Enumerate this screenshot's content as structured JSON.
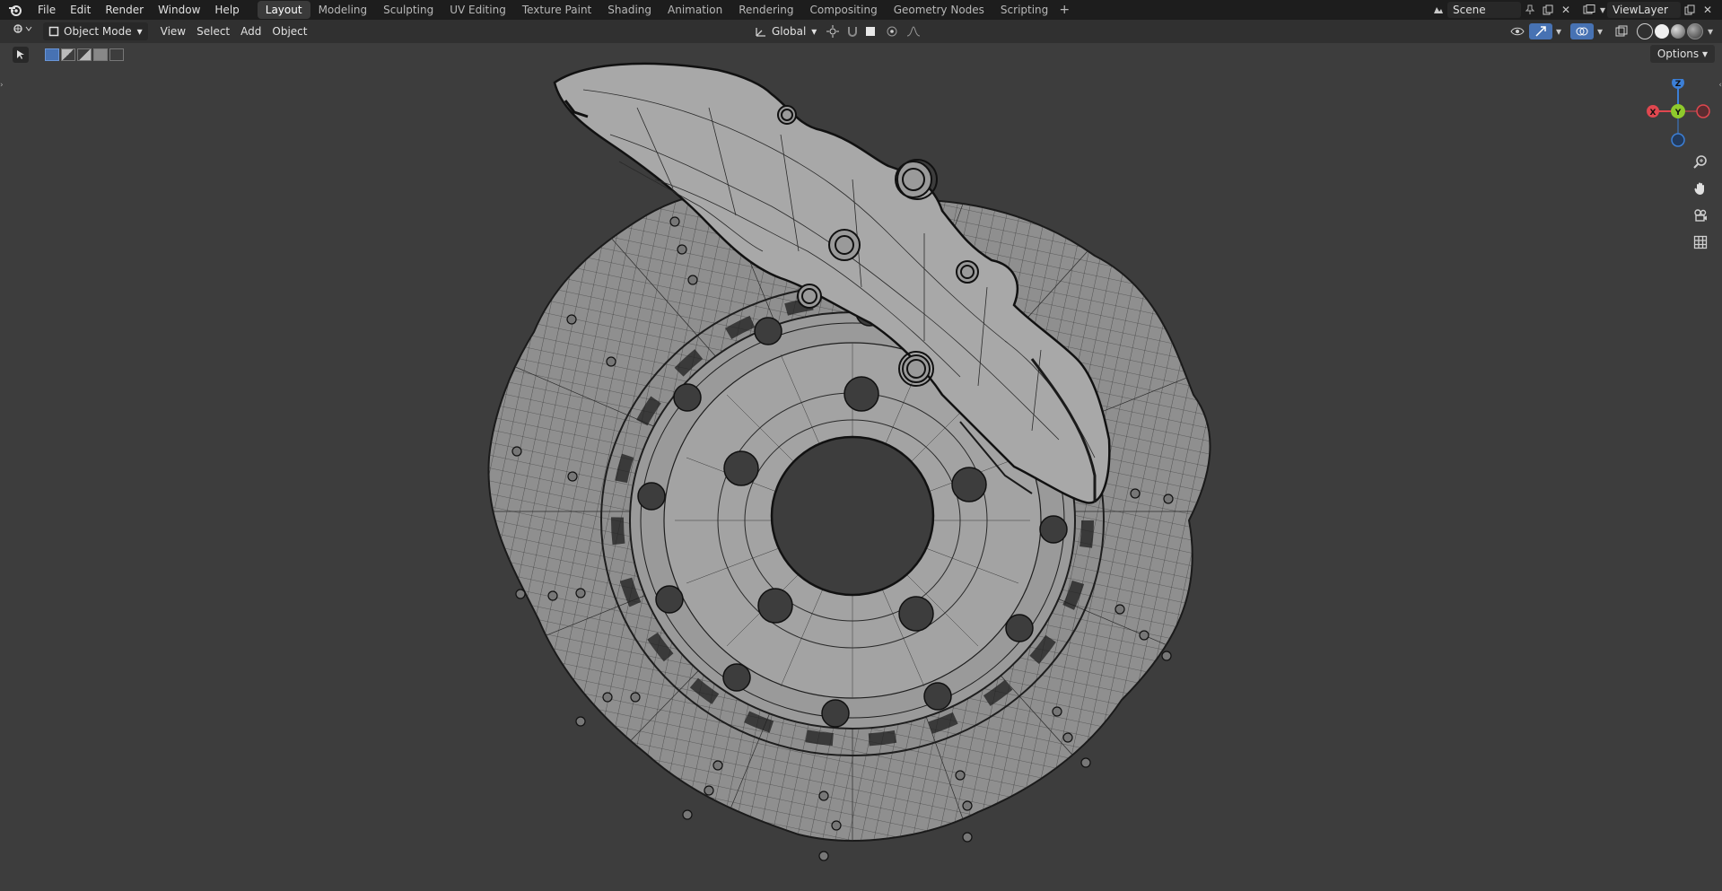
{
  "menu": [
    "File",
    "Edit",
    "Render",
    "Window",
    "Help"
  ],
  "workspace_tabs": [
    "Layout",
    "Modeling",
    "Sculpting",
    "UV Editing",
    "Texture Paint",
    "Shading",
    "Animation",
    "Rendering",
    "Compositing",
    "Geometry Nodes",
    "Scripting"
  ],
  "active_tab": "Layout",
  "scene": {
    "label": "Scene"
  },
  "view_layer": {
    "label": "ViewLayer"
  },
  "header": {
    "mode": "Object Mode",
    "view": "View",
    "select": "Select",
    "add": "Add",
    "object": "Object",
    "transform_orientation": "Global"
  },
  "options_label": "Options",
  "gizmo_axes": {
    "x": "X",
    "y": "Y",
    "z": "Z"
  },
  "colors": {
    "x": "#e0474f",
    "y": "#8fca2c",
    "z": "#3c7fd6",
    "selection": "#4772b3"
  },
  "icons": [
    "blender-logo-icon",
    "editor-type-icon",
    "pin-icon",
    "new-scene-icon",
    "render-layer-icon",
    "zoom-icon",
    "hand-pan-icon",
    "camera-icon",
    "grid-icon"
  ]
}
